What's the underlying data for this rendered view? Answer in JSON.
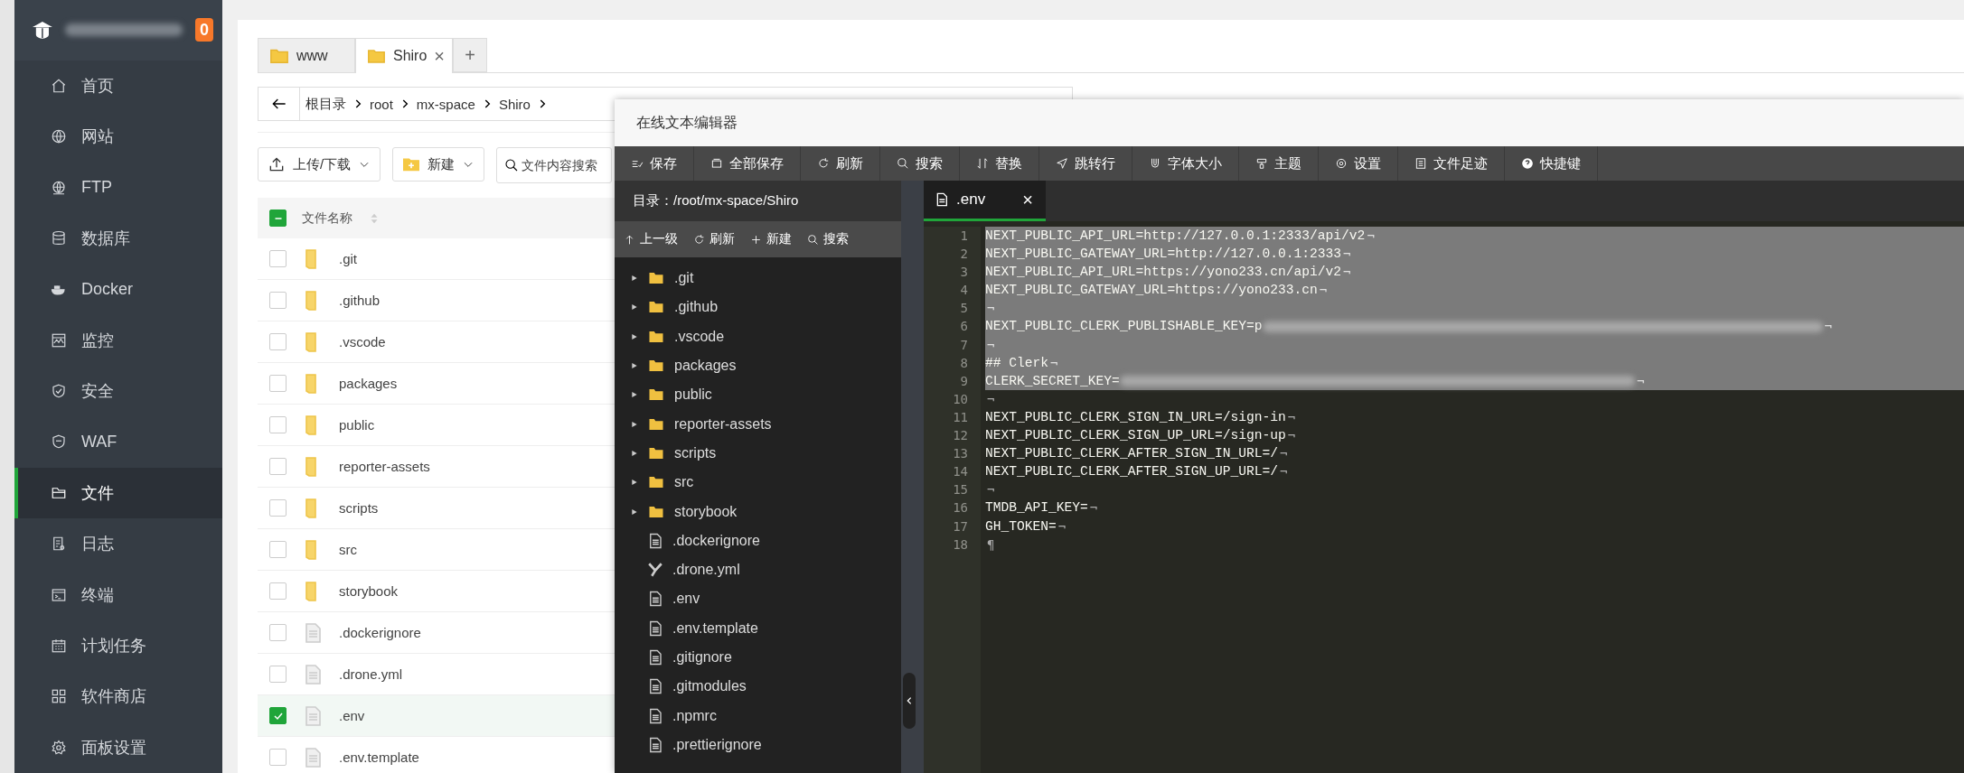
{
  "sidebar": {
    "badge": "0",
    "items": [
      {
        "label": "首页",
        "selected": false
      },
      {
        "label": "网站",
        "selected": false
      },
      {
        "label": "FTP",
        "selected": false
      },
      {
        "label": "数据库",
        "selected": false
      },
      {
        "label": "Docker",
        "selected": false
      },
      {
        "label": "监控",
        "selected": false
      },
      {
        "label": "安全",
        "selected": false
      },
      {
        "label": "WAF",
        "selected": false
      },
      {
        "label": "文件",
        "selected": true
      },
      {
        "label": "日志",
        "selected": false
      },
      {
        "label": "终端",
        "selected": false
      },
      {
        "label": "计划任务",
        "selected": false
      },
      {
        "label": "软件商店",
        "selected": false
      },
      {
        "label": "面板设置",
        "selected": false
      }
    ]
  },
  "file_manager": {
    "tabs": [
      {
        "label": "www",
        "selected": false
      },
      {
        "label": "Shiro",
        "selected": true,
        "close": "×"
      }
    ],
    "add_tab": "+",
    "breadcrumb": [
      "根目录",
      "root",
      "mx-space",
      "Shiro"
    ],
    "toolbar": [
      "上传/下载",
      "新建"
    ],
    "search": {
      "placeholder": "文件内容搜索"
    },
    "table": {
      "header_checkbox": {
        "checked": true,
        "indeterminate": true
      },
      "columns": [
        "文件名称"
      ],
      "rows": [
        {
          "name": ".git",
          "kind": "folder",
          "checked": false
        },
        {
          "name": ".github",
          "kind": "folder",
          "checked": false
        },
        {
          "name": ".vscode",
          "kind": "folder",
          "checked": false
        },
        {
          "name": "packages",
          "kind": "folder",
          "checked": false
        },
        {
          "name": "public",
          "kind": "folder",
          "checked": false
        },
        {
          "name": "reporter-assets",
          "kind": "folder",
          "checked": false
        },
        {
          "name": "scripts",
          "kind": "folder",
          "checked": false
        },
        {
          "name": "src",
          "kind": "folder",
          "checked": false
        },
        {
          "name": "storybook",
          "kind": "folder",
          "checked": false
        },
        {
          "name": ".dockerignore",
          "kind": "file",
          "checked": false
        },
        {
          "name": ".drone.yml",
          "kind": "file",
          "checked": false
        },
        {
          "name": ".env",
          "kind": "file",
          "checked": true
        },
        {
          "name": ".env.template",
          "kind": "file",
          "checked": false
        }
      ]
    }
  },
  "editor": {
    "title": "在线文本编辑器",
    "toolbar": [
      "保存",
      "全部保存",
      "刷新",
      "搜索",
      "替换",
      "跳转行",
      "字体大小",
      "主题",
      "设置",
      "文件足迹",
      "快捷键"
    ],
    "directory": "目录：/root/mx-space/Shiro",
    "tree_toolbar": [
      "上一级",
      "刷新",
      "新建",
      "搜索"
    ],
    "tree": [
      {
        "name": ".git",
        "kind": "folder"
      },
      {
        "name": ".github",
        "kind": "folder"
      },
      {
        "name": ".vscode",
        "kind": "folder"
      },
      {
        "name": "packages",
        "kind": "folder"
      },
      {
        "name": "public",
        "kind": "folder"
      },
      {
        "name": "reporter-assets",
        "kind": "folder"
      },
      {
        "name": "scripts",
        "kind": "folder"
      },
      {
        "name": "src",
        "kind": "folder"
      },
      {
        "name": "storybook",
        "kind": "folder"
      },
      {
        "name": ".dockerignore",
        "kind": "file"
      },
      {
        "name": ".drone.yml",
        "kind": "yaml"
      },
      {
        "name": ".env",
        "kind": "file"
      },
      {
        "name": ".env.template",
        "kind": "file"
      },
      {
        "name": ".gitignore",
        "kind": "file"
      },
      {
        "name": ".gitmodules",
        "kind": "file"
      },
      {
        "name": ".npmrc",
        "kind": "file"
      },
      {
        "name": ".prettierignore",
        "kind": "file"
      }
    ],
    "file_tabs": [
      {
        "label": ".env",
        "selected": true,
        "close": "×"
      }
    ],
    "lines": [
      {
        "number": "1",
        "text": "NEXT_PUBLIC_API_URL=http://127.0.0.1:2333/api/v2",
        "eol": "¬",
        "selected": true,
        "redacted": false
      },
      {
        "number": "2",
        "text": "NEXT_PUBLIC_GATEWAY_URL=http://127.0.0.1:2333",
        "eol": "¬",
        "selected": true,
        "redacted": false
      },
      {
        "number": "3",
        "text": "NEXT_PUBLIC_API_URL=https://yono233.cn/api/v2",
        "eol": "¬",
        "selected": true,
        "redacted": false
      },
      {
        "number": "4",
        "text": "NEXT_PUBLIC_GATEWAY_URL=https://yono233.cn",
        "eol": "¬",
        "selected": true,
        "redacted": false
      },
      {
        "number": "5",
        "eol": "¬",
        "selected": true,
        "redacted": false
      },
      {
        "number": "6",
        "text": "NEXT_PUBLIC_CLERK_PUBLISHABLE_KEY=p",
        "eol": "¬",
        "selected": true,
        "redacted": true
      },
      {
        "number": "7",
        "eol": "¬",
        "selected": true,
        "redacted": false
      },
      {
        "number": "8",
        "text": "## Clerk",
        "eol": "¬",
        "selected": true,
        "redacted": false
      },
      {
        "number": "9",
        "text": "CLERK_SECRET_KEY=",
        "eol": "¬",
        "selected": true,
        "redacted": true
      },
      {
        "number": "10",
        "eol": "¬",
        "selected": false,
        "redacted": false
      },
      {
        "number": "11",
        "text": "NEXT_PUBLIC_CLERK_SIGN_IN_URL=/sign-in",
        "eol": "¬",
        "selected": false,
        "redacted": false
      },
      {
        "number": "12",
        "text": "NEXT_PUBLIC_CLERK_SIGN_UP_URL=/sign-up",
        "eol": "¬",
        "selected": false,
        "redacted": false
      },
      {
        "number": "13",
        "text": "NEXT_PUBLIC_CLERK_AFTER_SIGN_IN_URL=/",
        "eol": "¬",
        "selected": false,
        "redacted": false
      },
      {
        "number": "14",
        "text": "NEXT_PUBLIC_CLERK_AFTER_SIGN_UP_URL=/",
        "eol": "¬",
        "selected": false,
        "redacted": false
      },
      {
        "number": "15",
        "eol": "¬",
        "selected": false,
        "redacted": false
      },
      {
        "number": "16",
        "text": "TMDB_API_KEY=",
        "eol": "¬",
        "selected": false,
        "redacted": false
      },
      {
        "number": "17",
        "text": "GH_TOKEN=",
        "eol": "¬",
        "selected": false,
        "redacted": false
      },
      {
        "number": "18",
        "eol": "¶",
        "selected": false,
        "redacted": false
      }
    ]
  }
}
